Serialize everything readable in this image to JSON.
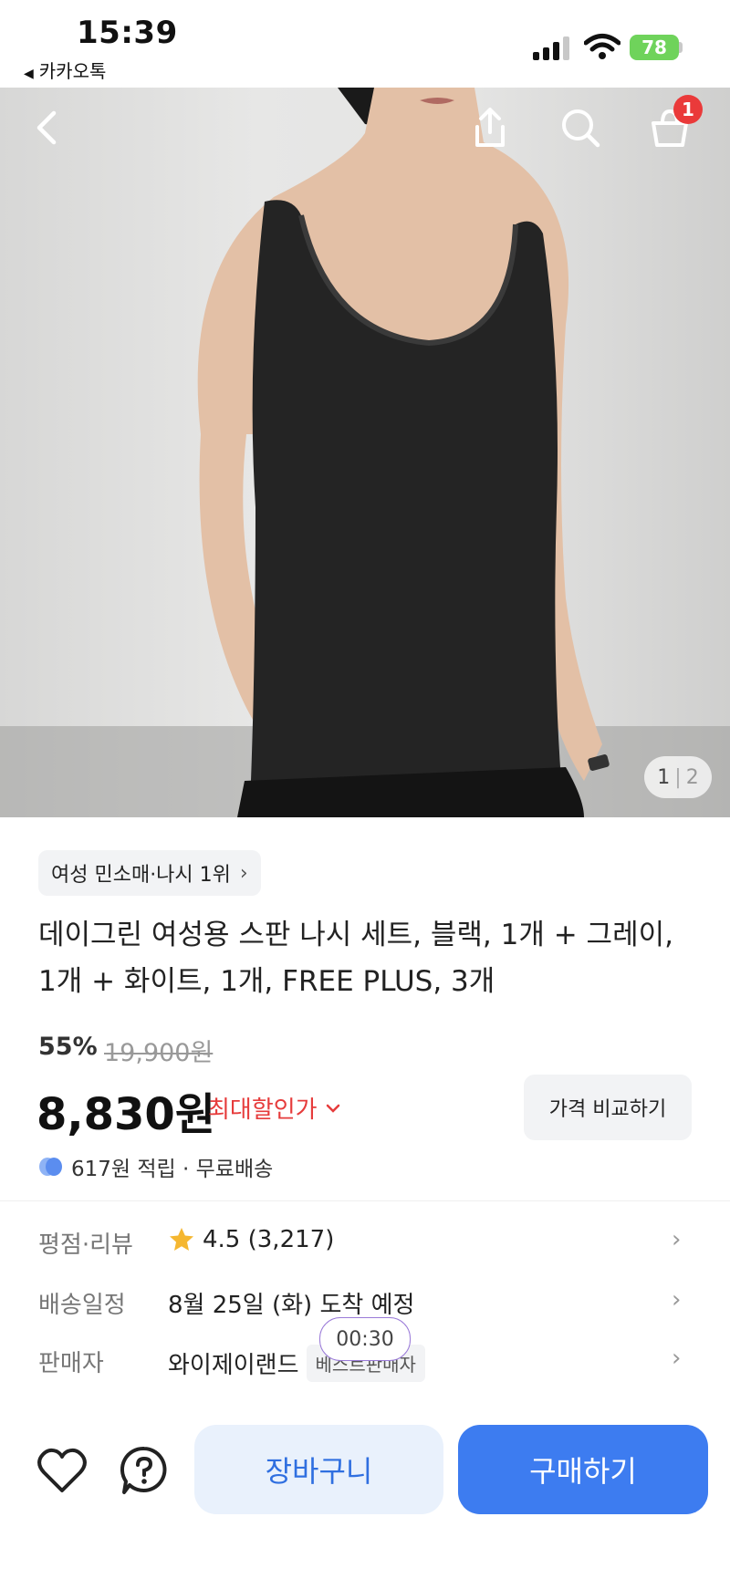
{
  "status_bar": {
    "time": "15:39",
    "back_app": "카카오톡",
    "battery": "78"
  },
  "top_nav": {
    "cart_badge": "1"
  },
  "hero": {
    "pager_current": "1",
    "pager_total": "2"
  },
  "product": {
    "rank_chip": "여성 민소매·나시 1위",
    "title": "데이그린 여성용 스판 나시 세트, 블랙, 1개 + 그레이, 1개 + 화이트, 1개, FREE PLUS, 3개",
    "discount": "55%",
    "original_price": "19,900원",
    "price": "8,830원",
    "max_discount_label": "최대할인가",
    "compare_button": "가격 비교하기",
    "points_text": "617원 적립 · 무료배송"
  },
  "info": {
    "rating_label": "평점·리뷰",
    "rating_value": "4.5 (3,217)",
    "shipping_label": "배송일정",
    "shipping_value": "8월 25일 (화) 도착 예정",
    "seller_label": "판매자",
    "seller_value": "와이제이랜드",
    "seller_chip": "베스트판매자",
    "timer": "00:30"
  },
  "bottom": {
    "cart_button": "장바구니",
    "buy_button": "구매하기"
  },
  "colors": {
    "accent": "#3d7cf0",
    "sale_red": "#e63c3c",
    "badge_red": "#ea3a3a",
    "star": "#f5b731"
  }
}
